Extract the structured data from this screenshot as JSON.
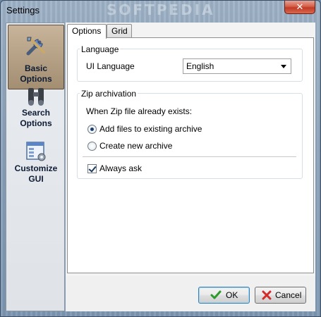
{
  "window": {
    "title": "Settings",
    "watermark": "SOFTPEDIA",
    "close_label": "✕"
  },
  "nav": {
    "items": [
      {
        "label_line1": "Basic Options",
        "label_line2": "",
        "icon": "tools-icon",
        "active": true
      },
      {
        "label_line1": "Search",
        "label_line2": "Options",
        "icon": "binoculars-icon",
        "active": false
      },
      {
        "label_line1": "Customize",
        "label_line2": "GUI",
        "icon": "gui-icon",
        "active": false
      }
    ]
  },
  "tabs": [
    {
      "label": "Options",
      "active": true
    },
    {
      "label": "Grid",
      "active": false
    }
  ],
  "language_group": {
    "title": "Language",
    "ui_language_label": "UI Language",
    "ui_language_value": "English"
  },
  "zip_group": {
    "title": "Zip archivation",
    "prompt": "When Zip file already exists:",
    "options": [
      {
        "label": "Add files to existing archive",
        "checked": true
      },
      {
        "label": "Create new archive",
        "checked": false
      }
    ],
    "always_ask_label": "Always ask",
    "always_ask_checked": true
  },
  "buttons": {
    "ok": "OK",
    "cancel": "Cancel"
  }
}
